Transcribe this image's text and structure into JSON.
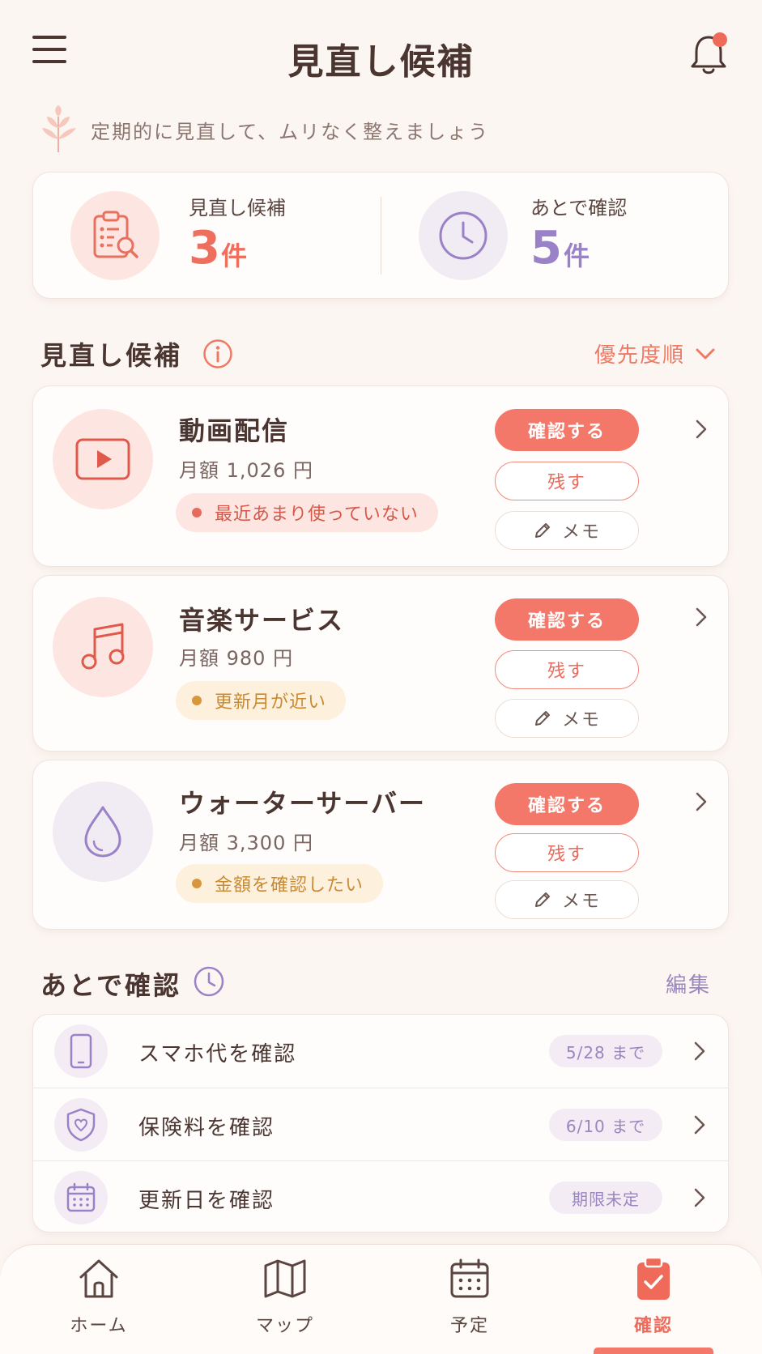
{
  "header": {
    "title": "見直し候補",
    "tagline": "定期的に見直して、ムリなく整えましょう"
  },
  "summary": {
    "candidates": {
      "label": "見直し候補",
      "count": "3",
      "unit": "件"
    },
    "later": {
      "label": "あとで確認",
      "count": "5",
      "unit": "件"
    }
  },
  "candidates_section": {
    "title": "見直し候補",
    "sort_label": "優先度順",
    "items": [
      {
        "name": "動画配信",
        "price": "月額 1,026 円",
        "badge": "最近あまり使っていない",
        "icon": "video-play-icon",
        "confirm": "確認する",
        "keep": "残す",
        "memo": "メモ"
      },
      {
        "name": "音楽サービス",
        "price": "月額 980 円",
        "badge": "更新月が近い",
        "icon": "music-note-icon",
        "confirm": "確認する",
        "keep": "残す",
        "memo": "メモ"
      },
      {
        "name": "ウォーターサーバー",
        "price": "月額 3,300 円",
        "badge": "金額を確認したい",
        "icon": "water-drop-icon",
        "confirm": "確認する",
        "keep": "残す",
        "memo": "メモ"
      }
    ]
  },
  "later_section": {
    "title": "あとで確認",
    "edit_label": "編集",
    "items": [
      {
        "label": "スマホ代を確認",
        "due": "5/28 まで",
        "icon": "smartphone-icon"
      },
      {
        "label": "保険料を確認",
        "due": "6/10 まで",
        "icon": "shield-heart-icon"
      },
      {
        "label": "更新日を確認",
        "due": "期限未定",
        "icon": "calendar-icon"
      }
    ]
  },
  "nav": {
    "items": [
      {
        "label": "ホーム",
        "icon": "home-icon"
      },
      {
        "label": "マップ",
        "icon": "map-icon"
      },
      {
        "label": "予定",
        "icon": "calendar-icon"
      },
      {
        "label": "確認",
        "icon": "clipboard-check-icon",
        "active": true
      }
    ]
  },
  "colors": {
    "accent": "#f3786a",
    "purple": "#9a86be",
    "background": "#fcf6f2"
  }
}
